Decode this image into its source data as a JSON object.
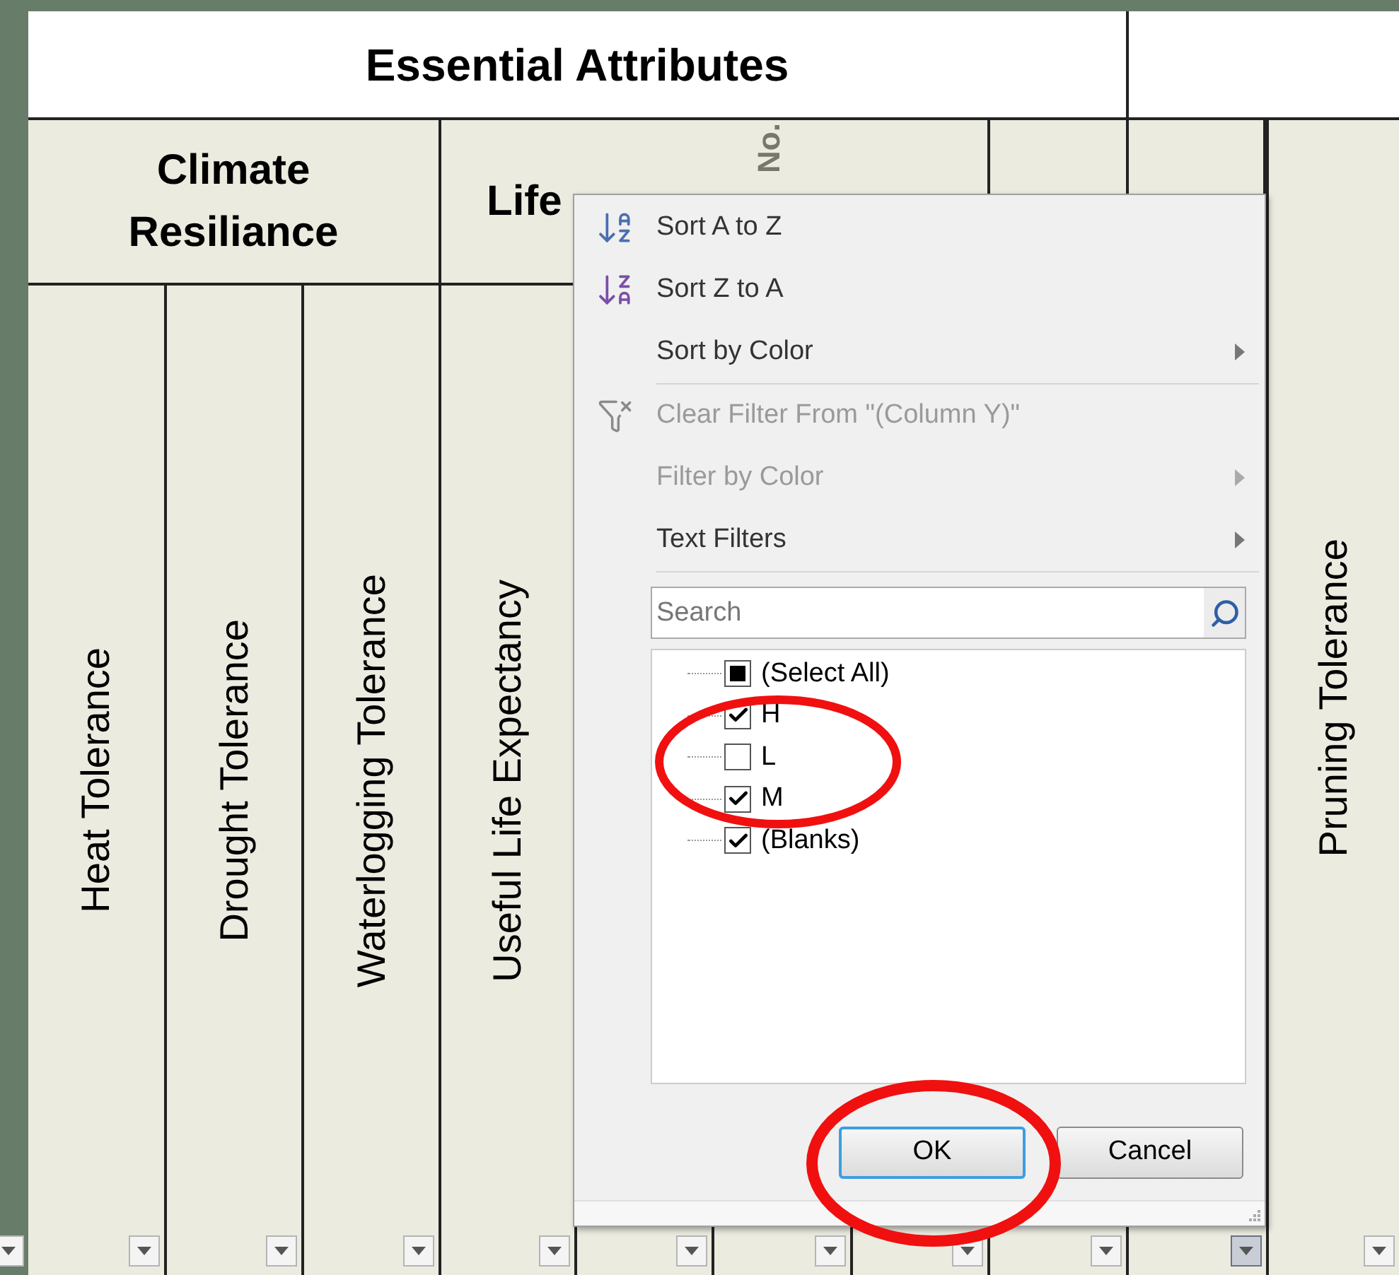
{
  "header": {
    "title": "Essential Attributes"
  },
  "groups": [
    {
      "label": "Climate Resiliance"
    },
    {
      "label": "Life"
    }
  ],
  "rotated_note": "No.",
  "columns": [
    {
      "label": "Heat Tolerance"
    },
    {
      "label": "Drought Tolerance"
    },
    {
      "label": "Waterlogging Tolerance"
    },
    {
      "label": "Useful Life Expectancy"
    },
    {
      "label": "Pruning Tolerance"
    }
  ],
  "filter_buttons": [
    {
      "open": false
    },
    {
      "open": false
    },
    {
      "open": false
    },
    {
      "open": false
    },
    {
      "open": false
    },
    {
      "open": false
    },
    {
      "open": false
    },
    {
      "open": false
    },
    {
      "open": false
    },
    {
      "open": true
    },
    {
      "open": false
    }
  ],
  "menu": {
    "items": [
      {
        "kind": "sort_asc",
        "label": "Sort A to Z",
        "disabled": false,
        "submenu": false
      },
      {
        "kind": "sort_desc",
        "label": "Sort Z to A",
        "disabled": false,
        "submenu": false
      },
      {
        "kind": "plain",
        "label": "Sort by Color",
        "disabled": false,
        "submenu": true
      },
      {
        "kind": "separator"
      },
      {
        "kind": "clear_filter",
        "label": "Clear Filter From \"(Column Y)\"",
        "disabled": true,
        "submenu": false
      },
      {
        "kind": "plain",
        "label": "Filter by Color",
        "disabled": true,
        "submenu": true
      },
      {
        "kind": "plain",
        "label": "Text Filters",
        "disabled": false,
        "submenu": true
      }
    ],
    "search": {
      "placeholder": "Search"
    },
    "values": [
      {
        "label": "(Select All)",
        "checked": false,
        "mixed": true
      },
      {
        "label": "H",
        "checked": true,
        "mixed": false
      },
      {
        "label": "L",
        "checked": false,
        "mixed": false
      },
      {
        "label": "M",
        "checked": true,
        "mixed": false
      },
      {
        "label": "(Blanks)",
        "checked": true,
        "mixed": false
      }
    ],
    "buttons": [
      {
        "label": "OK",
        "default": true
      },
      {
        "label": "Cancel",
        "default": false
      }
    ]
  }
}
